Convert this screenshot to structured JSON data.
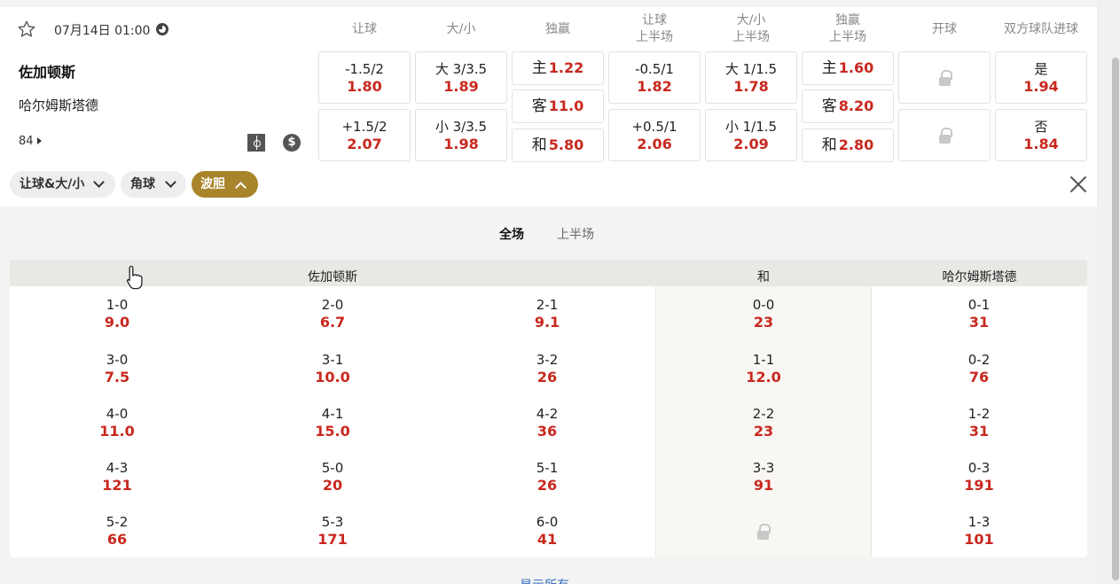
{
  "match": {
    "time": "07月14日 01:00",
    "home": "佐加顿斯",
    "away": "哈尔姆斯塔德",
    "minute": "84"
  },
  "columns": {
    "handicap": "让球",
    "over_under": "大/小",
    "one_x_two": "独赢",
    "handicap_h1_a": "让球",
    "handicap_h1_b": "上半场",
    "ou_h1_a": "大/小",
    "ou_h1_b": "上半场",
    "oxt_h1_a": "独赢",
    "oxt_h1_b": "上半场",
    "kickoff": "开球",
    "btts": "双方球队进球"
  },
  "odds": {
    "hdp": [
      {
        "line": "-1.5/2",
        "odds": "1.80"
      },
      {
        "line": "+1.5/2",
        "odds": "2.07"
      }
    ],
    "ou": [
      {
        "line": "大 3/3.5",
        "odds": "1.89"
      },
      {
        "line": "小 3/3.5",
        "odds": "1.98"
      }
    ],
    "oxt": [
      {
        "label": "主",
        "odds": "1.22"
      },
      {
        "label": "客",
        "odds": "11.0"
      },
      {
        "label": "和",
        "odds": "5.80"
      }
    ],
    "hdp_h1": [
      {
        "line": "-0.5/1",
        "odds": "1.82"
      },
      {
        "line": "+0.5/1",
        "odds": "2.06"
      }
    ],
    "ou_h1": [
      {
        "line": "大 1/1.5",
        "odds": "1.78"
      },
      {
        "line": "小 1/1.5",
        "odds": "2.09"
      }
    ],
    "oxt_h1": [
      {
        "label": "主",
        "odds": "1.60"
      },
      {
        "label": "客",
        "odds": "8.20"
      },
      {
        "label": "和",
        "odds": "2.80"
      }
    ],
    "btts": [
      {
        "label": "是",
        "odds": "1.94"
      },
      {
        "label": "否",
        "odds": "1.84"
      }
    ]
  },
  "filters": {
    "hdp_ou": "让球&大/小",
    "corners": "角球",
    "correct_score": "波胆"
  },
  "tabs": {
    "full": "全场",
    "first_half": "上半场"
  },
  "grid_headers": {
    "home": "佐加顿斯",
    "draw": "和",
    "away": "哈尔姆斯塔德"
  },
  "scores": {
    "home1": [
      {
        "s": "1-0",
        "o": "9.0"
      },
      {
        "s": "3-0",
        "o": "7.5"
      },
      {
        "s": "4-0",
        "o": "11.0"
      },
      {
        "s": "4-3",
        "o": "121"
      },
      {
        "s": "5-2",
        "o": "66"
      }
    ],
    "home2": [
      {
        "s": "2-0",
        "o": "6.7"
      },
      {
        "s": "3-1",
        "o": "10.0"
      },
      {
        "s": "4-1",
        "o": "15.0"
      },
      {
        "s": "5-0",
        "o": "20"
      },
      {
        "s": "5-3",
        "o": "171"
      }
    ],
    "home3": [
      {
        "s": "2-1",
        "o": "9.1"
      },
      {
        "s": "3-2",
        "o": "26"
      },
      {
        "s": "4-2",
        "o": "36"
      },
      {
        "s": "5-1",
        "o": "26"
      },
      {
        "s": "6-0",
        "o": "41"
      }
    ],
    "draw": [
      {
        "s": "0-0",
        "o": "23"
      },
      {
        "s": "1-1",
        "o": "12.0"
      },
      {
        "s": "2-2",
        "o": "23"
      },
      {
        "s": "3-3",
        "o": "91"
      }
    ],
    "away": [
      {
        "s": "0-1",
        "o": "31"
      },
      {
        "s": "0-2",
        "o": "76"
      },
      {
        "s": "1-2",
        "o": "31"
      },
      {
        "s": "0-3",
        "o": "191"
      },
      {
        "s": "1-3",
        "o": "101"
      }
    ]
  },
  "show_all": "显示所有",
  "colors": {
    "odds": "#c8281e",
    "active_pill": "#a8842a"
  },
  "icons": [
    "star-icon",
    "clock-icon",
    "pitch-icon",
    "dollar-icon",
    "lock-icon",
    "chevron-down-icon",
    "chevron-up-icon",
    "close-icon",
    "hand-cursor-icon"
  ]
}
